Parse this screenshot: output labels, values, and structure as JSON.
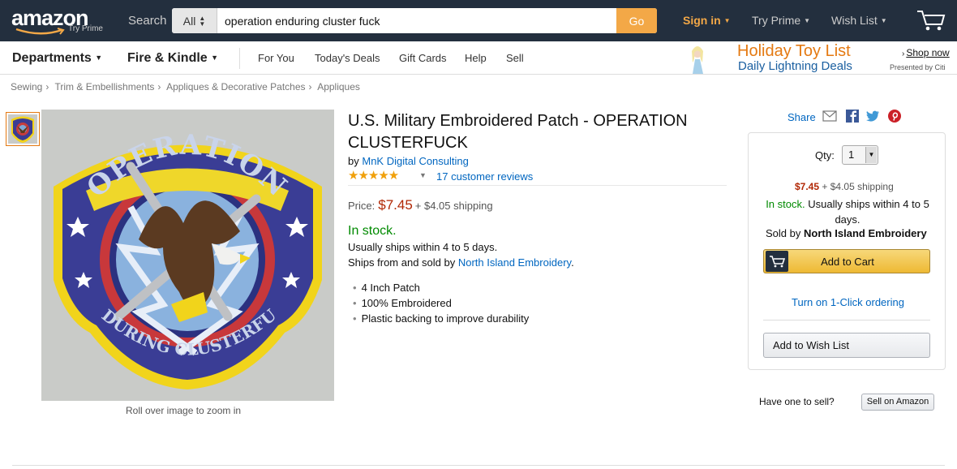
{
  "header": {
    "logo_text": "amazon",
    "logo_sub": "Try Prime",
    "search_label": "Search",
    "search_category": "All",
    "search_value": "operation enduring cluster fuck",
    "search_go": "Go",
    "sign_in": "Sign in",
    "try_prime": "Try Prime",
    "wish_list": "Wish List"
  },
  "subnav": {
    "departments": "Departments",
    "fire_kindle": "Fire & Kindle",
    "links": [
      "For You",
      "Today's Deals",
      "Gift Cards",
      "Help",
      "Sell"
    ],
    "promo_title": "Holiday Toy List",
    "promo_sub": "Daily Lightning Deals",
    "promo_shop": "Shop now",
    "promo_by": "Presented by Citi"
  },
  "breadcrumb": [
    "Sewing",
    "Trim & Embellishments",
    "Appliques & Decorative Patches",
    "Appliques"
  ],
  "image": {
    "zoom_text": "Roll over image to zoom in",
    "patch_top_text": "OPERATION",
    "patch_bottom_text": "ENDURING CLUSTERFUCK"
  },
  "product": {
    "title": "U.S. Military Embroidered Patch - OPERATION CLUSTERFUCK",
    "by_label": "by",
    "brand": "MnK Digital Consulting",
    "stars": "★★★★★",
    "rating": 4.5,
    "reviews": "17 customer reviews",
    "price_label": "Price:",
    "price": "$7.45",
    "shipping": "+ $4.05 shipping",
    "in_stock": "In stock.",
    "ships_within": "Usually ships within 4 to 5 days.",
    "ships_from_prefix": "Ships from and sold by",
    "seller": "North Island Embroidery",
    "ships_from_suffix": ".",
    "bullets": [
      "4 Inch Patch",
      "100% Embroidered",
      "Plastic backing to improve durability"
    ]
  },
  "buybox": {
    "share": "Share",
    "qty_label": "Qty:",
    "qty_value": "1",
    "price": "$7.45",
    "shipping": "+ $4.05 shipping",
    "in_stock": "In stock.",
    "ships_text": "Usually ships within 4 to 5 days.",
    "sold_by_label": "Sold by",
    "sold_by": "North Island Embroidery",
    "add_to_cart": "Add to Cart",
    "one_click": "Turn on 1-Click ordering",
    "add_to_wish": "Add to Wish List",
    "have_one": "Have one to sell?",
    "sell_on": "Sell on Amazon"
  },
  "colors": {
    "nav_bg": "#232f3e",
    "accent": "#f3a847",
    "price": "#b12704",
    "in_stock": "#008a00",
    "link": "#0066c0"
  }
}
